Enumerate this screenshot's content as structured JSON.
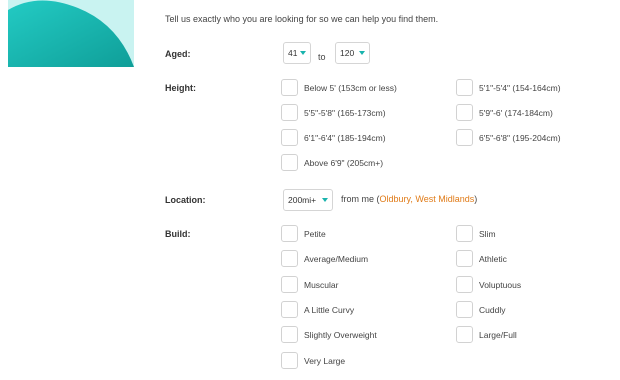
{
  "intro": "Tell us exactly who you are looking for so we can help you find them.",
  "labels": {
    "aged": "Aged:",
    "height": "Height:",
    "location": "Location:",
    "build": "Build:"
  },
  "age": {
    "from": "41",
    "to_text": "to",
    "to": "120"
  },
  "height_options": [
    "Below 5' (153cm or less)",
    "5'1\"-5'4\" (154-164cm)",
    "5'5\"-5'8\" (165-173cm)",
    "5'9\"-6' (174-184cm)",
    "6'1\"-6'4\" (185-194cm)",
    "6'5\"-6'8\" (195-204cm)",
    "Above 6'9\" (205cm+)"
  ],
  "location": {
    "distance": "200mi+",
    "from_text": "from me (",
    "place": "Oldbury, West Midlands",
    "close_paren": ")"
  },
  "build_options": [
    "Petite",
    "Slim",
    "Average/Medium",
    "Athletic",
    "Muscular",
    "Voluptuous",
    "A Little Curvy",
    "Cuddly",
    "Slightly Overweight",
    "Large/Full",
    "Very Large"
  ],
  "colors": {
    "accent": "#19b3ad",
    "hero_bg": "#c9f3f1",
    "place_link": "#e07b18"
  }
}
